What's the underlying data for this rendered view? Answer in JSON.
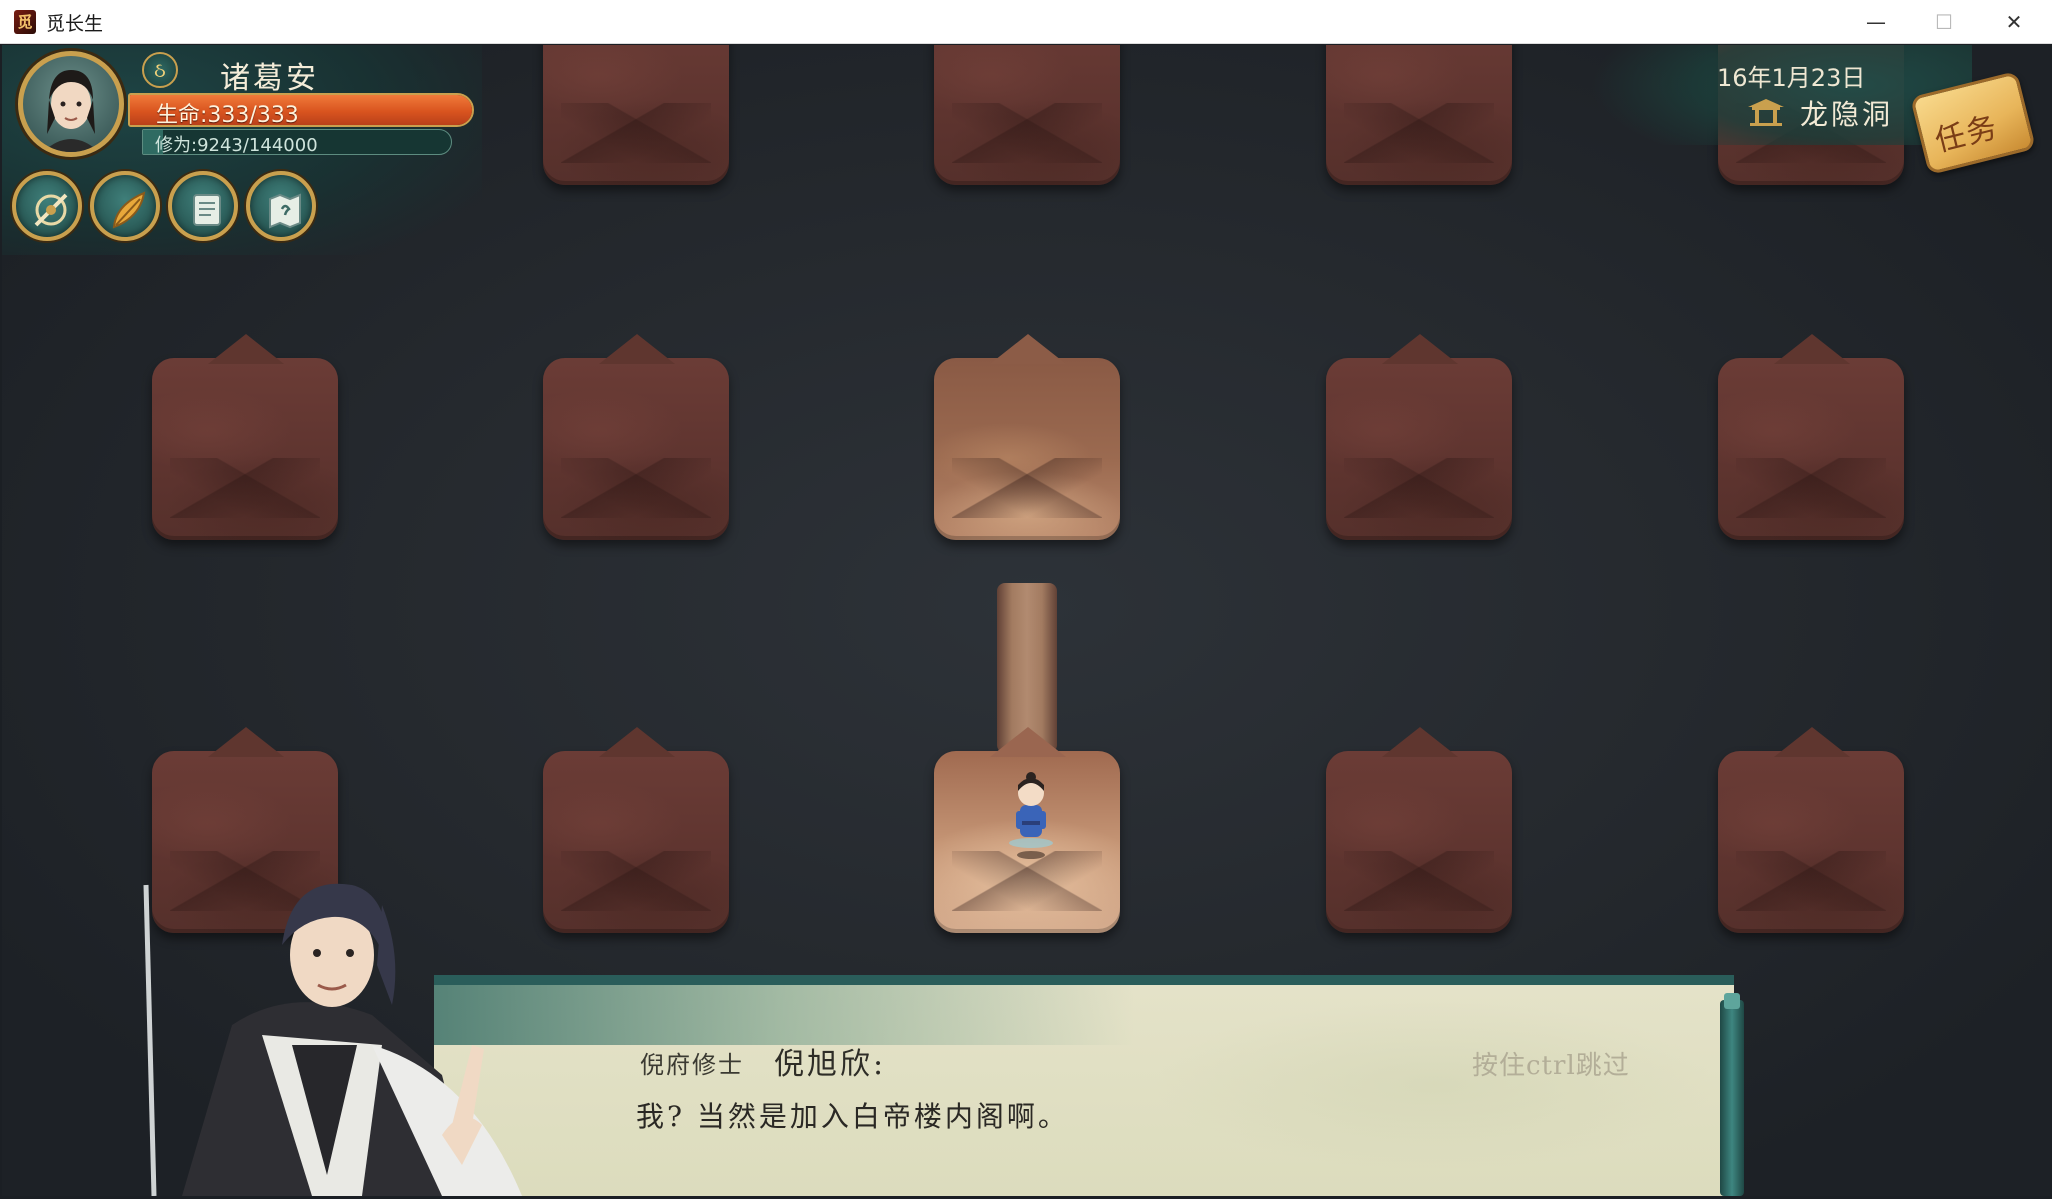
{
  "window": {
    "title": "觅长生",
    "icon_glyph": "觅",
    "controls": {
      "minimize": "—",
      "maximize": "☐",
      "close": "✕"
    }
  },
  "player": {
    "name": "诸葛安",
    "element_glyph": "ઠ",
    "hp_label": "生命",
    "hp_text": "生命:333/333",
    "hp_current": 333,
    "hp_max": 333,
    "cultivation_text": "修为:9243/144000",
    "cultivation_current": 9243,
    "cultivation_max": 144000
  },
  "skills": [
    {
      "icon": "sword-icon"
    },
    {
      "icon": "feather-icon"
    },
    {
      "icon": "scroll-icon"
    },
    {
      "icon": "map-icon"
    }
  ],
  "status": {
    "date": "16年1月23日",
    "location": "龙隐洞",
    "location_icon": "pavilion-icon"
  },
  "quest": {
    "label": "任务"
  },
  "map": {
    "rows": 3,
    "cols": 5,
    "current_tile": "row3-col3",
    "revealed_tile": "row2-col3"
  },
  "dialog": {
    "speaker_title": "倪府修士",
    "speaker_name": "倪旭欣:",
    "text": "我? 当然是加入白帝楼内阁啊。",
    "skip_hint": "按住ctrl跳过"
  },
  "colors": {
    "accent_gold": "#c9a04e",
    "hp_orange": "#d9541f",
    "teal": "#2a5d5a",
    "tile_brown": "#5e342f"
  }
}
